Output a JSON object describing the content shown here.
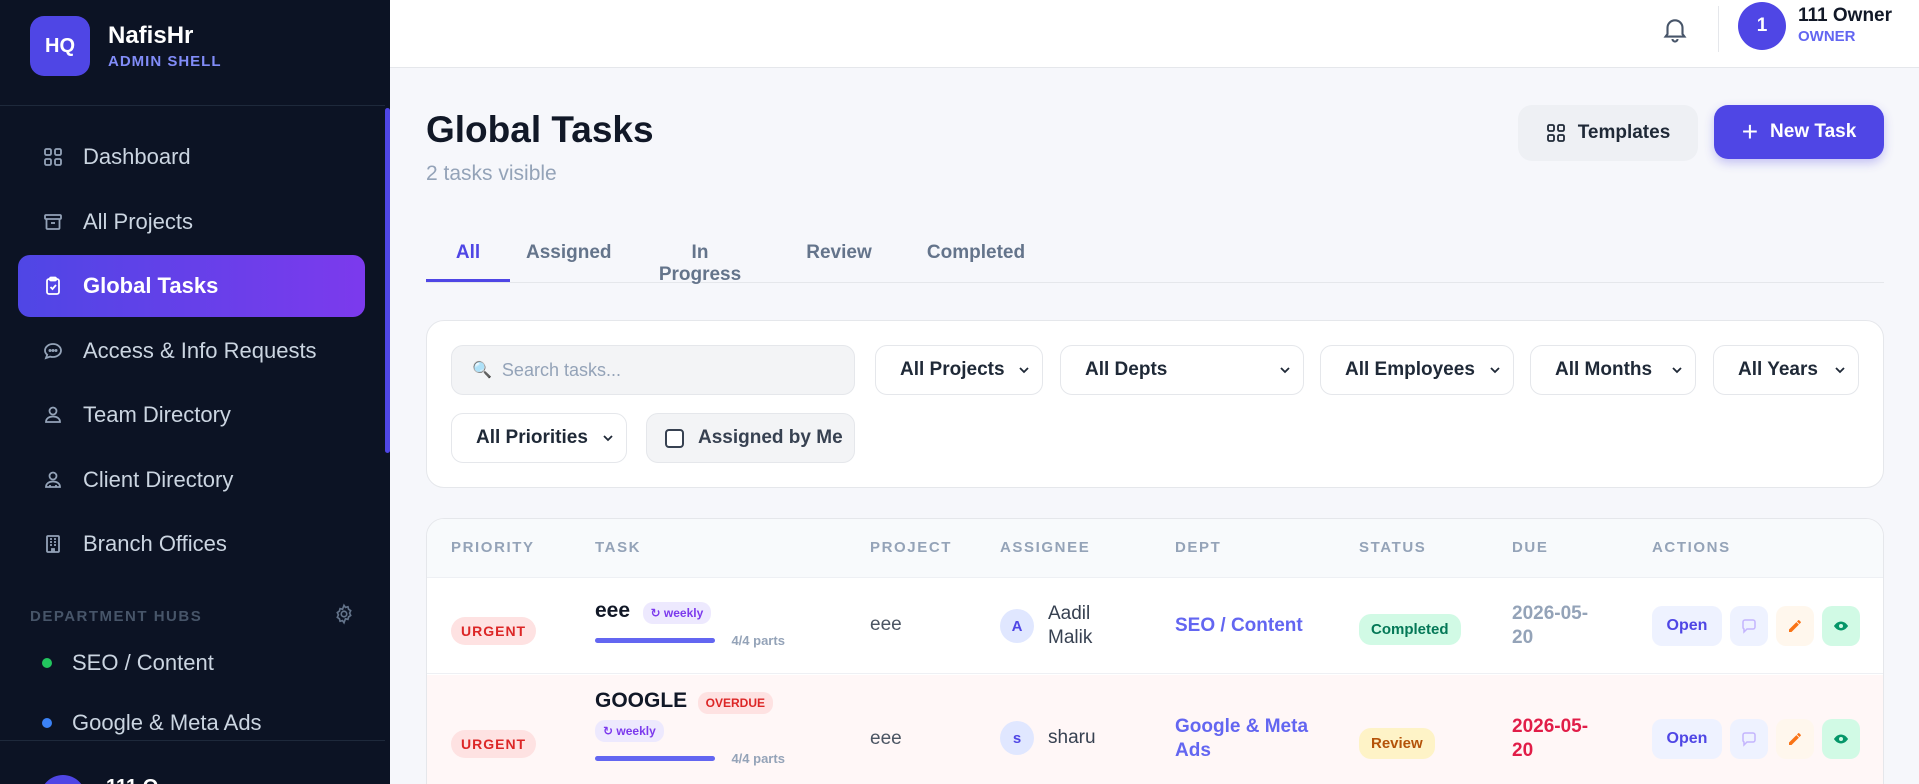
{
  "brand": {
    "logo": "HQ",
    "name": "NafisHr",
    "subtitle": "ADMIN SHELL"
  },
  "nav": [
    {
      "label": "Dashboard",
      "icon": "grid-icon",
      "active": false
    },
    {
      "label": "All Projects",
      "icon": "archive-icon",
      "active": false
    },
    {
      "label": "Global Tasks",
      "icon": "clipboard-icon",
      "active": true
    },
    {
      "label": "Access & Info Requests",
      "icon": "chat-icon",
      "active": false
    },
    {
      "label": "Team Directory",
      "icon": "user-icon",
      "active": false
    },
    {
      "label": "Client Directory",
      "icon": "users-icon",
      "active": false
    },
    {
      "label": "Branch Offices",
      "icon": "building-icon",
      "active": false
    }
  ],
  "hubs": {
    "title": "DEPARTMENT HUBS",
    "items": [
      {
        "label": "SEO / Content",
        "color": "#22c55e"
      },
      {
        "label": "Google & Meta Ads",
        "color": "#3b82f6"
      }
    ]
  },
  "sidebar_footer": {
    "name": "111 O"
  },
  "topbar": {
    "user_initial": "1",
    "user_name": "111 Owner",
    "user_role": "OWNER"
  },
  "page": {
    "title": "Global Tasks",
    "subtitle": "2 tasks visible",
    "templates_label": "Templates",
    "new_task_label": "New Task"
  },
  "tabs": [
    "All",
    "Assigned",
    "In Progress",
    "Review",
    "Completed"
  ],
  "filters": {
    "search_placeholder": "Search tasks...",
    "projects": "All Projects",
    "depts": "All Depts",
    "employees": "All Employees",
    "months": "All Months",
    "years": "All Years",
    "priorities": "All Priorities",
    "assigned_by_me": "Assigned by Me"
  },
  "table": {
    "headers": [
      "PRIORITY",
      "TASK",
      "PROJECT",
      "ASSIGNEE",
      "DEPT",
      "STATUS",
      "DUE",
      "ACTIONS"
    ],
    "rows": [
      {
        "priority": "URGENT",
        "task": "eee",
        "recurrence": "↻ weekly",
        "overdue": "",
        "parts": "4/4 parts",
        "progress": 1.0,
        "project": "eee",
        "assignee_initial": "A",
        "assignee_line1": "Aadil",
        "assignee_line2": "Malik",
        "dept_line1": "SEO / Content",
        "dept_line2": "",
        "status": "Completed",
        "due_line1": "2026-05-",
        "due_line2": "20",
        "open": "Open"
      },
      {
        "priority": "URGENT",
        "task": "GOOGLE",
        "recurrence": "↻ weekly",
        "overdue": "OVERDUE",
        "parts": "4/4 parts",
        "progress": 1.0,
        "project": "eee",
        "assignee_initial": "s",
        "assignee_line1": "sharu",
        "assignee_line2": "",
        "dept_line1": "Google & Meta",
        "dept_line2": "Ads",
        "status": "Review",
        "due_line1": "2026-05-",
        "due_line2": "20",
        "open": "Open"
      }
    ]
  },
  "colors": {
    "accent": "#4f46e5",
    "sidebar_bg": "#0c1324"
  }
}
